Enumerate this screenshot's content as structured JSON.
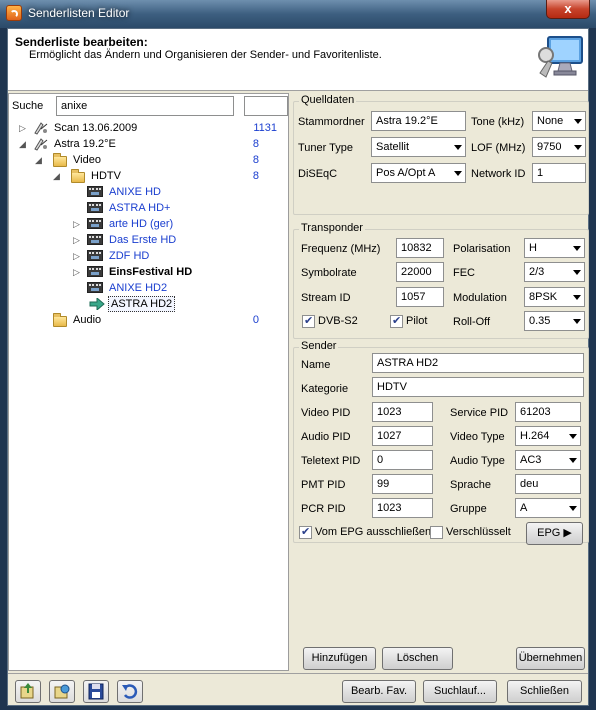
{
  "window": {
    "title": "Senderlisten Editor",
    "close_glyph": "x"
  },
  "header": {
    "title": "Senderliste bearbeiten:",
    "subtitle": "Ermöglicht das Ändern und Organisieren der Sender- und Favoritenliste.",
    "icon": "monitor-icon"
  },
  "search": {
    "label": "Suche",
    "value": "anixe",
    "extra_value": ""
  },
  "tree": {
    "scan": {
      "label": "Scan 13.06.2009",
      "count": "1131"
    },
    "astra": {
      "label": "Astra 19.2°E",
      "count": "8"
    },
    "video": {
      "label": "Video",
      "count": "8"
    },
    "hdtv": {
      "label": "HDTV",
      "count": "8"
    },
    "channels": [
      "ANIXE HD",
      "ASTRA HD+",
      "arte HD (ger)",
      "Das Erste HD",
      "ZDF HD",
      "EinsFestival HD",
      "ANIXE HD2",
      "ASTRA HD2"
    ],
    "audio": {
      "label": "Audio",
      "count": "0"
    }
  },
  "quelldaten": {
    "title": "Quelldaten",
    "stammordner_label": "Stammordner",
    "stammordner": "Astra 19.2°E",
    "tone_label": "Tone (kHz)",
    "tone": "None",
    "tuner_label": "Tuner Type",
    "tuner": "Satellit",
    "lof_label": "LOF (MHz)",
    "lof": "9750",
    "diseqc_label": "DiSEqC",
    "diseqc": "Pos A/Opt A",
    "network_label": "Network ID",
    "network": "1"
  },
  "transponder": {
    "title": "Transponder",
    "freq_label": "Frequenz (MHz)",
    "freq": "10832",
    "pol_label": "Polarisation",
    "pol": "H",
    "sr_label": "Symbolrate",
    "sr": "22000",
    "fec_label": "FEC",
    "fec": "2/3",
    "stream_label": "Stream ID",
    "stream": "1057",
    "mod_label": "Modulation",
    "mod": "8PSK",
    "dvbs2_label": "DVB-S2",
    "pilot_label": "Pilot",
    "rolloff_label": "Roll-Off",
    "rolloff": "0.35"
  },
  "sender": {
    "title": "Sender",
    "name_label": "Name",
    "name": "ASTRA HD2",
    "kat_label": "Kategorie",
    "kat": "HDTV",
    "vpid_label": "Video PID",
    "vpid": "1023",
    "spid_label": "Service PID",
    "spid": "61203",
    "apid_label": "Audio PID",
    "apid": "1027",
    "vtype_label": "Video Type",
    "vtype": "H.264",
    "tpid_label": "Teletext PID",
    "tpid": "0",
    "atype_label": "Audio Type",
    "atype": "AC3",
    "pmt_label": "PMT PID",
    "pmt": "99",
    "sprache_label": "Sprache",
    "sprache": "deu",
    "pcr_label": "PCR PID",
    "pcr": "1023",
    "gruppe_label": "Gruppe",
    "gruppe": "A",
    "epg_excl_label": "Vom EPG ausschließen",
    "encrypted_label": "Verschlüsselt",
    "epg_button": "EPG"
  },
  "actions": {
    "add": "Hinzufügen",
    "delete": "Löschen",
    "apply": "Übernehmen"
  },
  "footer": {
    "edit_fav": "Bearb. Fav.",
    "search_run": "Suchlauf...",
    "close": "Schließen"
  }
}
